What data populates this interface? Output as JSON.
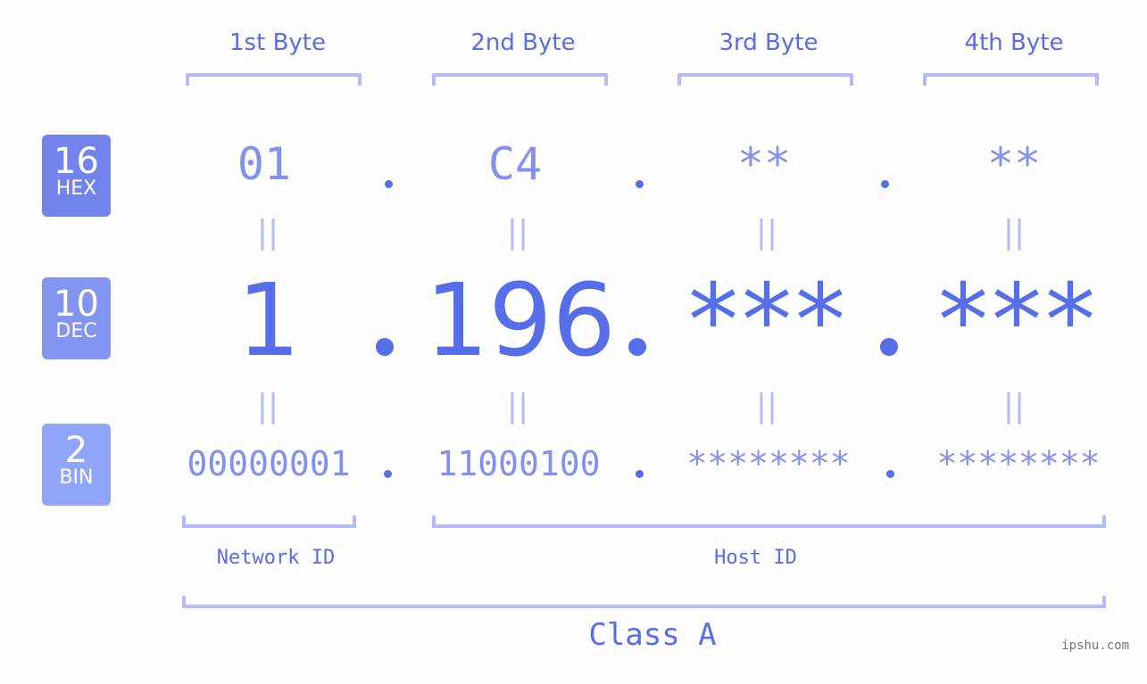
{
  "colors": {
    "accent": "#566ee9",
    "light_accent": "#8291ee",
    "bracket": "#b3bcf7",
    "hex_badge": "#7383ec",
    "dec_badge": "#8394f1",
    "bin_badge": "#8fa6f9",
    "background": "#fcfdfc"
  },
  "byte_headers": [
    "1st Byte",
    "2nd Byte",
    "3rd Byte",
    "4th Byte"
  ],
  "badges": {
    "hex": {
      "num": "16",
      "label": "HEX"
    },
    "dec": {
      "num": "10",
      "label": "DEC"
    },
    "bin": {
      "num": "2",
      "label": "BIN"
    }
  },
  "hex_values": [
    "01",
    "C4",
    "**",
    "**"
  ],
  "dec_values": [
    "1",
    "196",
    "***",
    "***"
  ],
  "bin_values": [
    "00000001",
    "11000100",
    "********",
    "********"
  ],
  "separator": ".",
  "equals": "||",
  "network_label": "Network ID",
  "host_label": "Host ID",
  "class_label": "Class A",
  "watermark": "ipshu.com"
}
